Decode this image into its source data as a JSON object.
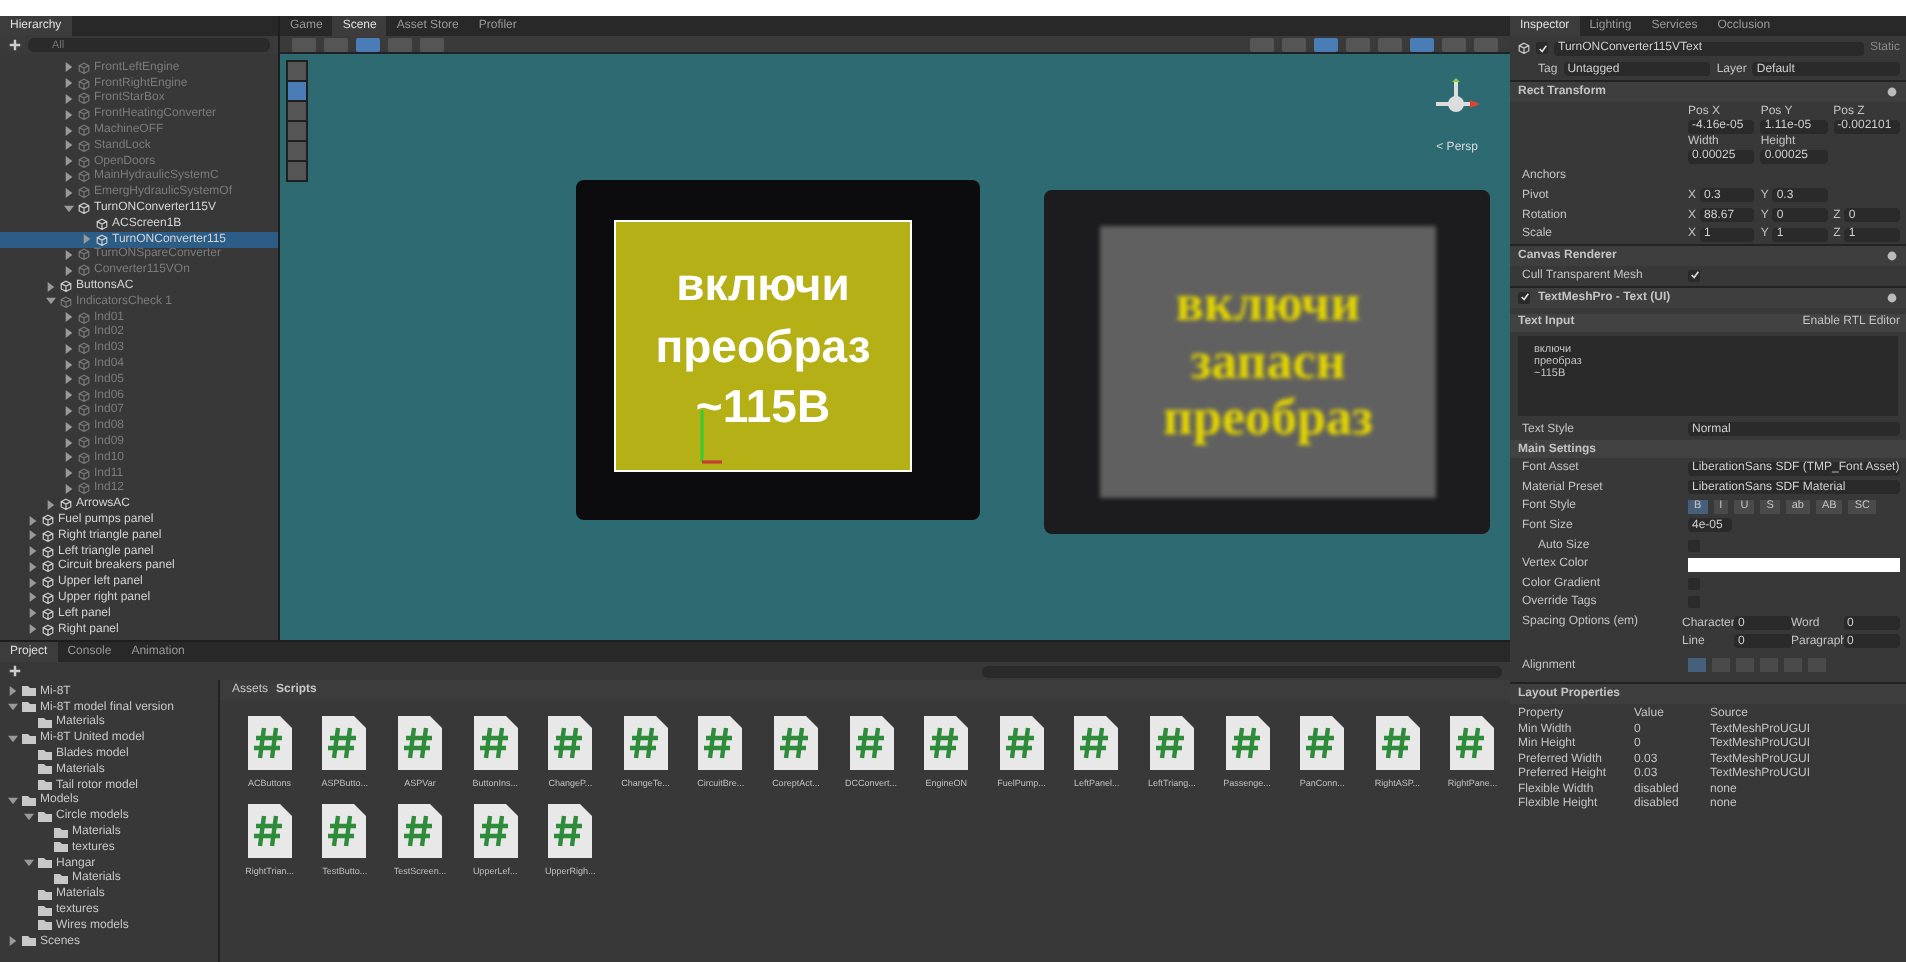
{
  "hierarchy": {
    "title": "Hierarchy",
    "search": {
      "placeholder": "All"
    },
    "items": [
      {
        "name": "FrontLeftEngine",
        "active": false,
        "expanded": false,
        "has_children": true,
        "selected": false
      },
      {
        "name": "FrontRightEngine",
        "active": false,
        "expanded": false,
        "has_children": true,
        "selected": false
      },
      {
        "name": "FrontStarBox",
        "active": false,
        "expanded": false,
        "has_children": true,
        "selected": false
      },
      {
        "name": "FrontHeatingConverter",
        "active": false,
        "expanded": false,
        "has_children": true,
        "selected": false
      },
      {
        "name": "MachineOFF",
        "active": false,
        "expanded": false,
        "has_children": true,
        "selected": false
      },
      {
        "name": "StandLock",
        "active": false,
        "expanded": false,
        "has_children": true,
        "selected": false
      },
      {
        "name": "OpenDoors",
        "active": false,
        "expanded": false,
        "has_children": true,
        "selected": false
      },
      {
        "name": "MainHydraulicSystemC",
        "active": false,
        "expanded": false,
        "has_children": true,
        "selected": false
      },
      {
        "name": "EmergHydraulicSystemOf",
        "active": false,
        "expanded": false,
        "has_children": true,
        "selected": false
      },
      {
        "name": "TurnONConverter115V",
        "active": true,
        "expanded": true,
        "has_children": true,
        "selected": false,
        "children": [
          {
            "name": "ACScreen1B",
            "active": true,
            "has_children": false,
            "selected": false
          },
          {
            "name": "TurnONConverter115",
            "active": true,
            "expanded": false,
            "has_children": true,
            "selected": true
          }
        ]
      },
      {
        "name": "TurnONSpareConverter",
        "active": false,
        "expanded": false,
        "has_children": true,
        "selected": false
      },
      {
        "name": "Converter115VOn",
        "active": false,
        "expanded": false,
        "has_children": true,
        "selected": false
      }
    ],
    "groups": [
      {
        "name": "ButtonsAC",
        "active": true,
        "expanded": false,
        "has_children": true,
        "selected": false
      },
      {
        "name": "IndicatorsCheck 1",
        "active": false,
        "expanded": true,
        "has_children": true,
        "selected": false,
        "children": [
          {
            "name": "Ind01",
            "active": false,
            "expanded": false,
            "has_children": true,
            "selected": false
          },
          {
            "name": "Ind02",
            "active": false,
            "expanded": false,
            "has_children": true,
            "selected": false
          },
          {
            "name": "Ind03",
            "active": false,
            "expanded": false,
            "has_children": true,
            "selected": false
          },
          {
            "name": "Ind04",
            "active": false,
            "expanded": false,
            "has_children": true,
            "selected": false
          },
          {
            "name": "Ind05",
            "active": false,
            "expanded": false,
            "has_children": true,
            "selected": false
          },
          {
            "name": "Ind06",
            "active": false,
            "expanded": false,
            "has_children": true,
            "selected": false
          },
          {
            "name": "Ind07",
            "active": false,
            "expanded": false,
            "has_children": true,
            "selected": false
          },
          {
            "name": "Ind08",
            "active": false,
            "expanded": false,
            "has_children": true,
            "selected": false
          },
          {
            "name": "Ind09",
            "active": false,
            "expanded": false,
            "has_children": true,
            "selected": false
          },
          {
            "name": "Ind10",
            "active": false,
            "expanded": false,
            "has_children": true,
            "selected": false
          },
          {
            "name": "Ind11",
            "active": false,
            "expanded": false,
            "has_children": true,
            "selected": false
          },
          {
            "name": "Ind12",
            "active": false,
            "expanded": false,
            "has_children": true,
            "selected": false
          }
        ]
      },
      {
        "name": "ArrowsAC",
        "active": true,
        "expanded": false,
        "has_children": true,
        "selected": false
      }
    ],
    "panels": [
      {
        "name": "Fuel pumps panel",
        "active": true,
        "expanded": false,
        "has_children": true,
        "selected": false
      },
      {
        "name": "Right triangle panel",
        "active": true,
        "expanded": false,
        "has_children": true,
        "selected": false
      },
      {
        "name": "Left triangle panel",
        "active": true,
        "expanded": false,
        "has_children": true,
        "selected": false
      },
      {
        "name": "Circuit breakers panel",
        "active": true,
        "expanded": false,
        "has_children": true,
        "selected": false
      },
      {
        "name": "Upper left panel",
        "active": true,
        "expanded": false,
        "has_children": true,
        "selected": false
      },
      {
        "name": "Upper right panel",
        "active": true,
        "expanded": false,
        "has_children": true,
        "selected": false
      },
      {
        "name": "Left panel",
        "active": true,
        "expanded": false,
        "has_children": true,
        "selected": false
      },
      {
        "name": "Right panel",
        "active": true,
        "expanded": false,
        "has_children": true,
        "selected": false
      }
    ]
  },
  "scene": {
    "tabs": [
      {
        "label": "Game",
        "selected": false
      },
      {
        "label": "Scene",
        "selected": true
      },
      {
        "label": "Asset Store",
        "selected": false
      },
      {
        "label": "Profiler",
        "selected": false
      }
    ],
    "persp": "< Persp",
    "left_sign": {
      "lines": [
        "включи",
        "преобраз",
        "~115В"
      ]
    },
    "right_sign": {
      "lines": [
        "включи",
        "запасн",
        "преобраз"
      ]
    }
  },
  "project": {
    "tabs": [
      {
        "label": "Project",
        "selected": true
      },
      {
        "label": "Console",
        "selected": false
      },
      {
        "label": "Animation",
        "selected": false
      }
    ],
    "tree": [
      {
        "name": "Mi-8T",
        "expanded": false
      },
      {
        "name": "Mi-8T model final version",
        "expanded": true,
        "children": [
          {
            "name": "Materials"
          }
        ]
      },
      {
        "name": "Mi-8T United model",
        "expanded": true,
        "children": [
          {
            "name": "Blades model"
          },
          {
            "name": "Materials"
          },
          {
            "name": "Tail rotor model"
          }
        ]
      },
      {
        "name": "Models",
        "expanded": true,
        "children": [
          {
            "name": "Circle models",
            "expanded": true,
            "children": [
              {
                "name": "Materials"
              },
              {
                "name": "textures"
              }
            ]
          },
          {
            "name": "Hangar",
            "expanded": true,
            "children": [
              {
                "name": "Materials"
              }
            ]
          },
          {
            "name": "Materials"
          },
          {
            "name": "textures"
          },
          {
            "name": "Wires models"
          }
        ]
      },
      {
        "name": "Scenes",
        "expanded": false
      }
    ],
    "breadcrumb": [
      "Assets",
      "Scripts"
    ],
    "assets": [
      "ACButtons",
      "ASPButto...",
      "ASPVar",
      "ButtonIns...",
      "ChangeP...",
      "ChangeTe...",
      "CircuitBre...",
      "CoreptAct...",
      "DCConvert...",
      "EngineON",
      "FuelPump...",
      "LeftPanel...",
      "LeftTriang...",
      "Passenge...",
      "PanConn...",
      "RightASP...",
      "RightPane...",
      "RightTrian...",
      "TestButto...",
      "TestScreen...",
      "UpperLef...",
      "UpperRigh..."
    ]
  },
  "inspector": {
    "tabs": [
      {
        "label": "Inspector",
        "selected": true
      },
      {
        "label": "Lighting",
        "selected": false
      },
      {
        "label": "Services",
        "selected": false
      },
      {
        "label": "Occlusion",
        "selected": false
      }
    ],
    "object": {
      "name": "TurnONConverter115VText",
      "active": true,
      "static": "Static"
    },
    "tag": {
      "label": "Tag",
      "value": "Untagged"
    },
    "layer": {
      "label": "Layer",
      "value": "Default"
    },
    "rect_transform": {
      "title": "Rect Transform",
      "pos_labels": [
        "Pos X",
        "Pos Y",
        "Pos Z"
      ],
      "pos_values": [
        "-4.16e-05",
        "1.11e-05",
        "-0.002101"
      ],
      "size_labels": [
        "Width",
        "Height"
      ],
      "size_values": [
        "0.00025",
        "0.00025"
      ],
      "anchors": "Anchors",
      "vectors": [
        {
          "label": "Pivot",
          "axes": [
            {
              "axis": "X",
              "value": "0.3"
            },
            {
              "axis": "Y",
              "value": "0.3"
            }
          ]
        },
        {
          "label": "Rotation",
          "axes": [
            {
              "axis": "X",
              "value": "88.67"
            },
            {
              "axis": "Y",
              "value": "0"
            },
            {
              "axis": "Z",
              "value": "0"
            }
          ]
        },
        {
          "label": "Scale",
          "axes": [
            {
              "axis": "X",
              "value": "1"
            },
            {
              "axis": "Y",
              "value": "1"
            },
            {
              "axis": "Z",
              "value": "1"
            }
          ]
        }
      ]
    },
    "canvas_renderer": {
      "title": "Canvas Renderer",
      "field": {
        "label": "Cull Transparent Mesh",
        "checked": true
      }
    },
    "tmp": {
      "title": "TextMeshPro - Text (UI)",
      "enabled": true,
      "text_input": "Text Input",
      "rtl": "Enable RTL Editor",
      "text": "включи\nпреобраз\n~115В",
      "rows": [
        {
          "kind": "dropdown",
          "label": "Text Style",
          "value": "Normal"
        },
        {
          "kind": "heading",
          "label": "Main Settings"
        },
        {
          "kind": "object",
          "label": "Font Asset",
          "value": "LiberationSans SDF (TMP_Font Asset)"
        },
        {
          "kind": "dropdown",
          "label": "Material Preset",
          "value": "LiberationSans SDF Material"
        },
        {
          "kind": "styles",
          "label": "Font Style",
          "options": [
            {
              "label": "B",
              "selected": true
            },
            {
              "label": "I",
              "selected": false
            },
            {
              "label": "U",
              "selected": false
            },
            {
              "label": "S",
              "selected": false
            },
            {
              "label": "ab",
              "selected": false
            },
            {
              "label": "AB",
              "selected": false
            },
            {
              "label": "SC",
              "selected": false
            }
          ]
        },
        {
          "kind": "number",
          "label": "Font Size",
          "value": "4e-05"
        },
        {
          "kind": "checkbox",
          "label": "Auto Size",
          "checked": false,
          "indent": true
        },
        {
          "kind": "color",
          "label": "Vertex Color",
          "color": "#ffffff"
        },
        {
          "kind": "checkbox",
          "label": "Color Gradient",
          "checked": false
        },
        {
          "kind": "checkbox",
          "label": "Override Tags",
          "checked": false
        },
        {
          "kind": "spacing",
          "label": "Spacing Options (em)",
          "pairs": [
            {
              "label": "Character",
              "value": "0"
            },
            {
              "label": "Word",
              "value": "0"
            },
            {
              "label": "Line",
              "value": "0"
            },
            {
              "label": "Paragraph",
              "value": "0"
            }
          ]
        },
        {
          "kind": "alignment",
          "label": "Alignment",
          "options": [
            {
              "selected": true
            },
            {
              "selected": false
            },
            {
              "selected": false
            },
            {
              "selected": false
            },
            {
              "selected": false
            },
            {
              "selected": false
            }
          ]
        }
      ]
    },
    "layout": {
      "title": "Layout Properties",
      "columns": [
        "Property",
        "Value",
        "Source"
      ],
      "rows": [
        [
          "Min Width",
          "0",
          "TextMeshProUGUI"
        ],
        [
          "Min Height",
          "0",
          "TextMeshProUGUI"
        ],
        [
          "Preferred Width",
          "0.03",
          "TextMeshProUGUI"
        ],
        [
          "Preferred Height",
          "0.03",
          "TextMeshProUGUI"
        ],
        [
          "Flexible Width",
          "disabled",
          "none"
        ],
        [
          "Flexible Height",
          "disabled",
          "none"
        ]
      ]
    }
  }
}
